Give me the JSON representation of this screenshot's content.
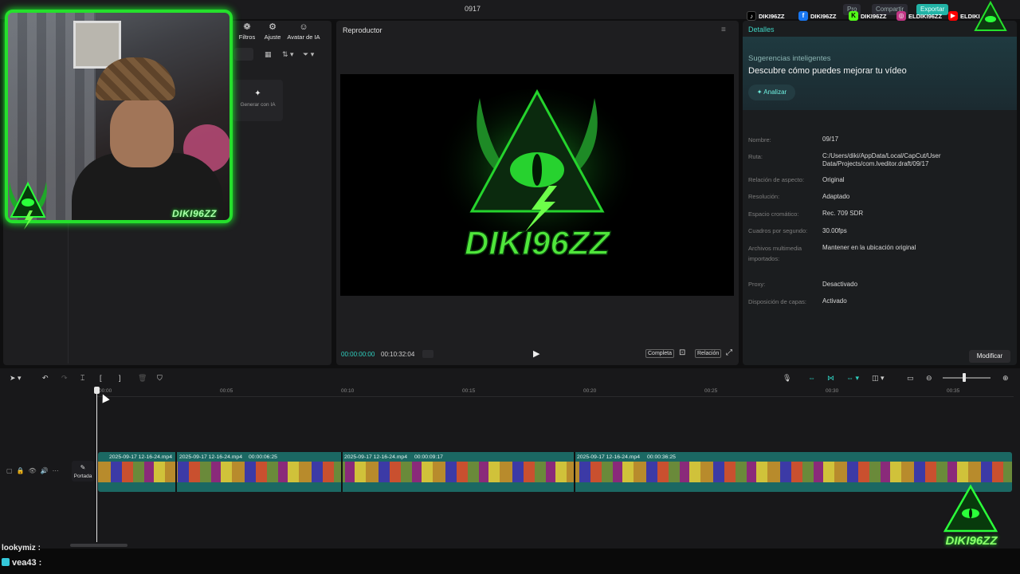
{
  "app": {
    "project_title": "0917",
    "top_buttons": [
      "Pro",
      "Compartir",
      "Exportar"
    ]
  },
  "media_toolbar": {
    "tools": [
      "Filtros",
      "Ajuste",
      "Avatar de IA"
    ]
  },
  "media": {
    "generate_card": "Generar con IA"
  },
  "webcam": {
    "streamer_name": "DIKI96ZZ"
  },
  "socials": [
    {
      "network": "tiktok",
      "handle": "DIKI96ZZ",
      "color": "#000000"
    },
    {
      "network": "facebook",
      "handle": "DIKI96ZZ",
      "color": "#1877f2"
    },
    {
      "network": "kick",
      "handle": "DIKI96ZZ",
      "color": "#53fc18"
    },
    {
      "network": "instagram",
      "handle": "ELDIKI96ZZ",
      "color": "#c13584"
    },
    {
      "network": "youtube",
      "handle": "ELDIKI",
      "color": "#ff0000"
    }
  ],
  "player": {
    "title": "Reproductor",
    "brand_text": "DIKI96ZZ",
    "time_current": "00:00:00:00",
    "time_total": "00:10:32:04",
    "buttons": {
      "full": "Completa",
      "ratio": "Relación"
    }
  },
  "details": {
    "tab": "Detalles",
    "suggestions_title": "Sugerencias inteligentes",
    "suggestions_subtitle": "Descubre cómo puedes mejorar tu vídeo",
    "analyze_label": "Analizar",
    "rows": [
      {
        "label": "Nombre:",
        "value": "09/17"
      },
      {
        "label": "Ruta:",
        "value": "C:/Users/diki/AppData/Local/CapCut/User Data/Projects/com.lveditor.draft/09/17"
      },
      {
        "label": "Relación de aspecto:",
        "value": "Original"
      },
      {
        "label": "Resolución:",
        "value": "Adaptado"
      },
      {
        "label": "Espacio cromático:",
        "value": "Rec. 709 SDR"
      },
      {
        "label": "Cuadros por segundo:",
        "value": "30.00fps"
      },
      {
        "label": "Archivos multimedia importados:",
        "value": "Mantener en la ubicación original"
      },
      {
        "label": "Proxy:",
        "value": "Desactivado"
      },
      {
        "label": "Disposición de capas:",
        "value": "Activado"
      }
    ],
    "modify_label": "Modificar"
  },
  "timeline": {
    "ticks": [
      "00:00",
      "00:05",
      "00:10",
      "00:15",
      "00:20",
      "00:25",
      "00:30",
      "00:35"
    ],
    "cover_label": "Portada",
    "clips": [
      {
        "name": "2025-09-17 12-16-24.mp4",
        "duration": ""
      },
      {
        "name": "2025-09-17 12-16-24.mp4",
        "duration": "00:00:06:25"
      },
      {
        "name": "2025-09-17 12-16-24.mp4",
        "duration": "00:00:09:17"
      },
      {
        "name": "2025-09-17 12-16-24.mp4",
        "duration": "00:00:36:25"
      }
    ],
    "zoom_level": 0.45
  },
  "chat": [
    {
      "user": "lookymiz :",
      "text": ""
    },
    {
      "user": "vea43 :",
      "text": ""
    }
  ],
  "brand": {
    "accent": "#25e02c",
    "teal": "#2fd1c1"
  }
}
